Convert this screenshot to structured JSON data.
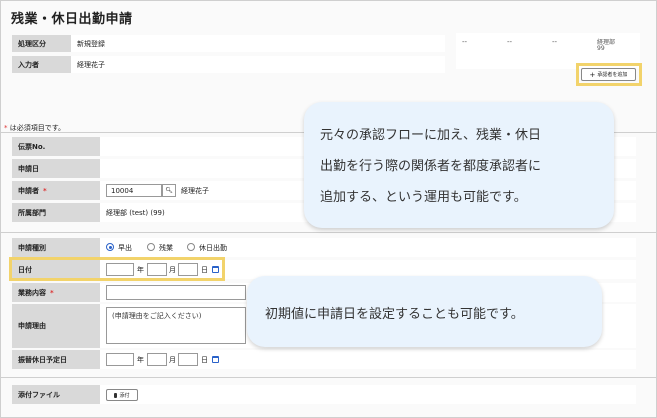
{
  "title": "残業・休日出勤申請",
  "header": {
    "process_label": "処理区分",
    "process_value": "新規登録",
    "entrant_label": "入力者",
    "entrant_value": "経理花子"
  },
  "approval": {
    "cells": [
      "--",
      "--",
      "--"
    ],
    "last_dept": "経理部",
    "last_code": "99",
    "add_label": "承認者を追加"
  },
  "required_note": "は必須項目です。",
  "required_mark": "*",
  "form": {
    "slip_no_label": "伝票No.",
    "apply_date_label": "申請日",
    "applicant_label": "申請者",
    "applicant_code": "10004",
    "applicant_name": "経理花子",
    "dept_label": "所属部門",
    "dept_value": "経理部 (test) (99)",
    "type_label": "申請種別",
    "type_options": [
      "早出",
      "残業",
      "休日出勤"
    ],
    "type_selected": "早出",
    "date_label": "日付",
    "year_unit": "年",
    "month_unit": "月",
    "day_unit": "日",
    "work_label": "業務内容",
    "reason_label": "申請理由",
    "reason_placeholder": "(申請理由をご記入ください)",
    "substitute_label": "振替休日予定日",
    "attachment_label": "添付ファイル",
    "attach_button": "添付"
  },
  "callouts": {
    "approver_lines": [
      "元々の承認フローに加え、残業・休日",
      "出勤を行う際の関係者を都度承認者に",
      "追加する、という運用も可能です。"
    ],
    "date_note": "初期値に申請日を設定することも可能です。"
  },
  "colors": {
    "label_bg": "#d9d9d9",
    "highlight": "#f2d36b",
    "bubble_bg": "#e9f3fd",
    "accent": "#2a62c9",
    "required": "#dd3333"
  }
}
